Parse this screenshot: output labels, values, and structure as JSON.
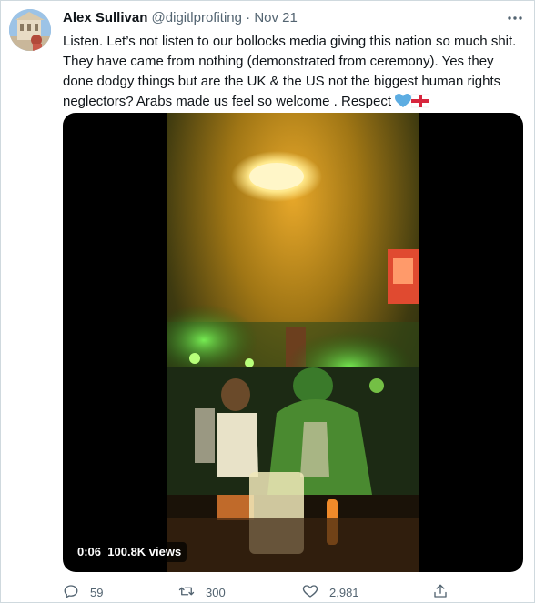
{
  "tweet": {
    "author_name": "Alex Sullivan",
    "handle": "@digitlprofiting",
    "separator": "·",
    "date": "Nov 21",
    "text": "Listen. Let’s not listen to our bollocks media giving this nation so much shit. They have came from nothing (demonstrated from ceremony). Yes they done dodgy things but are the UK & the US not the biggest human rights neglectors? Arabs made us feel so welcome . Respect"
  },
  "video": {
    "time": "0:06",
    "views": "100.8K views"
  },
  "actions": {
    "replies": "59",
    "retweets": "300",
    "likes": "2,981"
  },
  "icons": {
    "more": "more-icon",
    "reply": "reply-icon",
    "retweet": "retweet-icon",
    "like": "like-icon",
    "share": "share-icon"
  },
  "colors": {
    "text": "#0f1419",
    "secondary": "#536471",
    "border": "#cfd9de"
  }
}
